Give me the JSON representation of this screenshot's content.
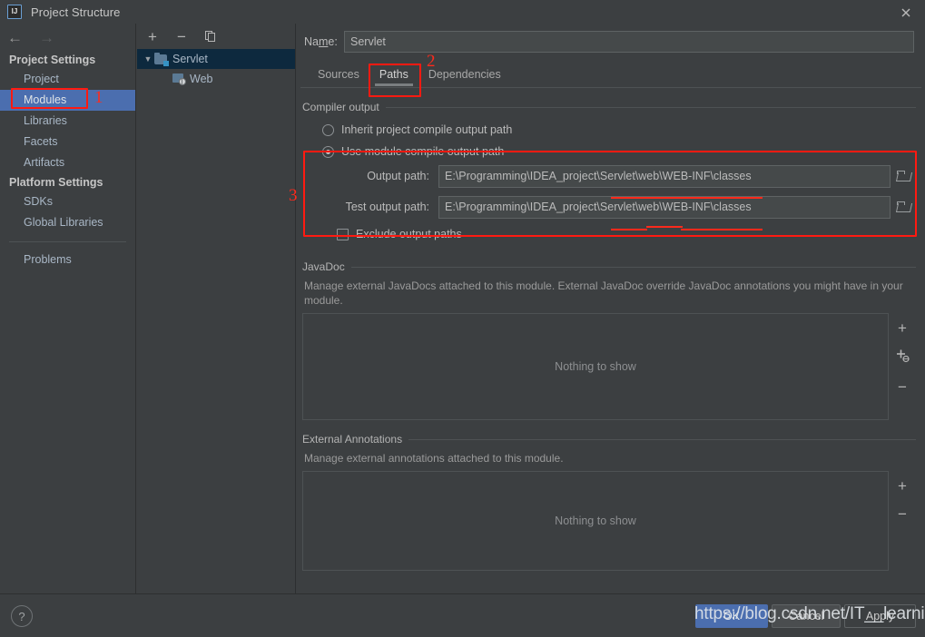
{
  "window": {
    "title": "Project Structure",
    "logo_text": "IJ",
    "close_icon": "close-icon"
  },
  "colors": {
    "background": "#3c3f41",
    "selection_blue": "#4b6eaf",
    "tree_selection": "#0d293e",
    "field_background": "#45494a",
    "annotation_red": "#ff1a11",
    "text": "#bbbbbb"
  },
  "sidebar": {
    "back_arrow": "←",
    "forward_arrow": "→",
    "groups": [
      {
        "heading": "Project Settings",
        "items": [
          {
            "label": "Project",
            "selected": false
          },
          {
            "label": "Modules",
            "selected": true
          },
          {
            "label": "Libraries",
            "selected": false
          },
          {
            "label": "Facets",
            "selected": false
          },
          {
            "label": "Artifacts",
            "selected": false
          }
        ]
      },
      {
        "heading": "Platform Settings",
        "items": [
          {
            "label": "SDKs",
            "selected": false
          },
          {
            "label": "Global Libraries",
            "selected": false
          }
        ]
      }
    ],
    "problems_label": "Problems"
  },
  "module_panel": {
    "toolbar": {
      "add_label": "+",
      "remove_label": "−",
      "copy_label": "copy-icon"
    },
    "tree": [
      {
        "label": "Servlet",
        "icon": "module-folder-icon",
        "selected": true,
        "expanded": true,
        "depth": 0
      },
      {
        "label": "Web",
        "icon": "web-facet-icon",
        "selected": false,
        "depth": 1
      }
    ]
  },
  "main": {
    "name_label_pre": "Na",
    "name_label_mnemonic": "m",
    "name_label_post": "e:",
    "name_value": "Servlet",
    "name_placeholder": "",
    "tabs": [
      {
        "label": "Sources",
        "active": false
      },
      {
        "label": "Paths",
        "active": true
      },
      {
        "label": "Dependencies",
        "active": false
      }
    ],
    "compiler_output": {
      "group_title": "Compiler output",
      "inherit_label": "Inherit project compile output path",
      "inherit_selected": false,
      "use_module_label": "Use module compile output path",
      "use_module_selected": true,
      "output_path_label": "Output path:",
      "output_path_value": "E:\\Programming\\IDEA_project\\Servlet\\web\\WEB-INF\\classes",
      "test_output_path_label": "Test output path:",
      "test_output_path_value": "E:\\Programming\\IDEA_project\\Servlet\\web\\WEB-INF\\classes",
      "browse_icon": "folder-browse-icon",
      "exclude_label": "Exclude output paths",
      "exclude_checked": false
    },
    "javadoc": {
      "group_title": "JavaDoc",
      "description": "Manage external JavaDocs attached to this module. External JavaDoc override JavaDoc annotations you might have in your module.",
      "empty_text": "Nothing to show",
      "buttons": [
        {
          "icon": "plus-icon",
          "label": "+"
        },
        {
          "icon": "add-url-icon",
          "label": "+"
        },
        {
          "icon": "minus-icon",
          "label": "−"
        }
      ]
    },
    "external_annotations": {
      "group_title": "External Annotations",
      "description": "Manage external annotations attached to this module.",
      "empty_text": "Nothing to show",
      "buttons": [
        {
          "icon": "plus-icon",
          "label": "+"
        },
        {
          "icon": "minus-icon",
          "label": "−"
        }
      ]
    }
  },
  "footer": {
    "help_label": "?",
    "ok_label": "OK",
    "cancel_label": "Cancel",
    "apply_label": "Apply"
  },
  "watermark": {
    "text": "https://blog.csdn.net/IT__learning"
  },
  "annotations": [
    {
      "number": "1",
      "target": "sidebar-item-modules"
    },
    {
      "number": "2",
      "target": "tab-paths"
    },
    {
      "number": "3",
      "target": "compiler-output-module-section"
    }
  ]
}
